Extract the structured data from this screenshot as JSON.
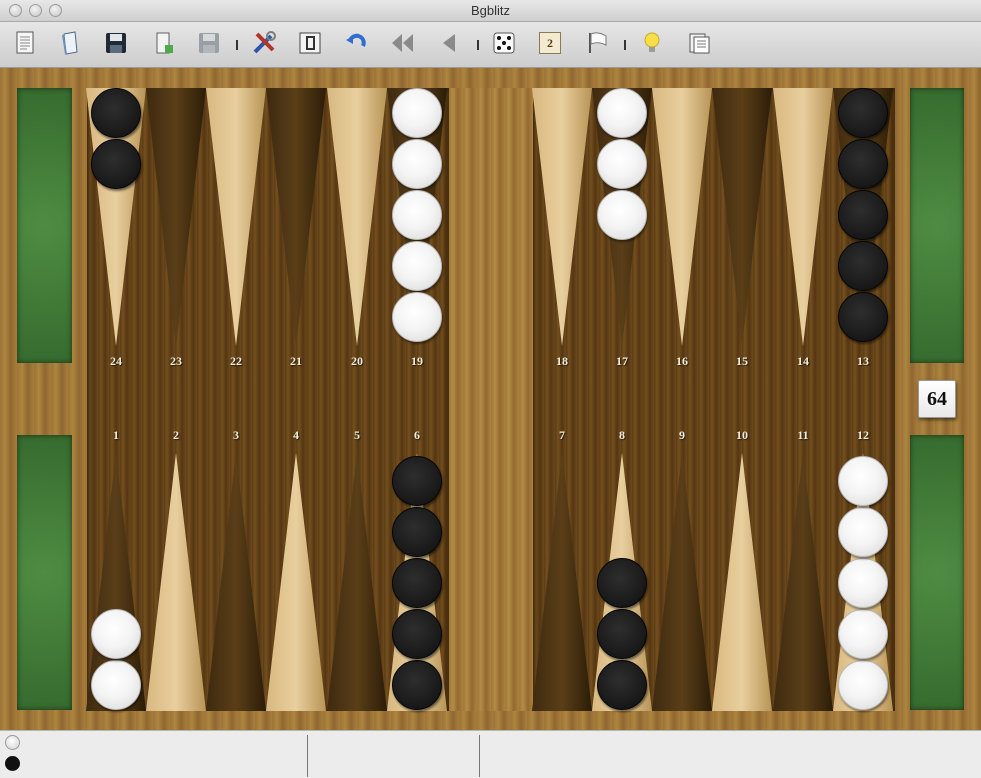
{
  "window": {
    "title": "Bgblitz"
  },
  "toolbar": {
    "buttons": [
      {
        "name": "new-match-button",
        "icon": "document-icon"
      },
      {
        "name": "open-button",
        "icon": "open-document-icon"
      },
      {
        "name": "save-button",
        "icon": "floppy-disk-icon"
      },
      {
        "name": "export-button",
        "icon": "document-export-icon"
      },
      {
        "name": "save-as-button",
        "icon": "floppy-disk-disabled-icon"
      },
      {
        "name": "settings-button",
        "icon": "tools-icon"
      },
      {
        "name": "board-edit-button",
        "icon": "board-icon"
      },
      {
        "name": "undo-button",
        "icon": "undo-arrow-icon"
      },
      {
        "name": "rewind-button",
        "icon": "double-back-arrow-icon"
      },
      {
        "name": "back-button",
        "icon": "back-arrow-icon"
      },
      {
        "name": "roll-dice-button",
        "icon": "dice-icon"
      },
      {
        "name": "double-button",
        "icon": "doubling-cube-icon",
        "label": "2"
      },
      {
        "name": "resign-button",
        "icon": "white-flag-icon"
      },
      {
        "name": "hint-button",
        "icon": "light-bulb-icon"
      },
      {
        "name": "analysis-button",
        "icon": "notes-icon"
      }
    ]
  },
  "board": {
    "doubling_cube": "64",
    "top_points": [
      "24",
      "23",
      "22",
      "21",
      "20",
      "19",
      "18",
      "17",
      "16",
      "15",
      "14",
      "13"
    ],
    "bottom_points": [
      "1",
      "2",
      "3",
      "4",
      "5",
      "6",
      "7",
      "8",
      "9",
      "10",
      "11",
      "12"
    ],
    "position": [
      {
        "point": 24,
        "color": "black",
        "count": 2
      },
      {
        "point": 19,
        "color": "white",
        "count": 5
      },
      {
        "point": 17,
        "color": "white",
        "count": 3
      },
      {
        "point": 13,
        "color": "black",
        "count": 5
      },
      {
        "point": 1,
        "color": "white",
        "count": 2
      },
      {
        "point": 6,
        "color": "black",
        "count": 5
      },
      {
        "point": 8,
        "color": "black",
        "count": 3
      },
      {
        "point": 12,
        "color": "white",
        "count": 5
      }
    ]
  },
  "statusbar": {
    "players": [
      "white",
      "black"
    ]
  },
  "colors": {
    "white_checker": "#f4f4f4",
    "black_checker": "#1d1d1d",
    "felt": "#3f7a37",
    "light_point": "#d9b880",
    "dark_point": "#3e2a10"
  }
}
